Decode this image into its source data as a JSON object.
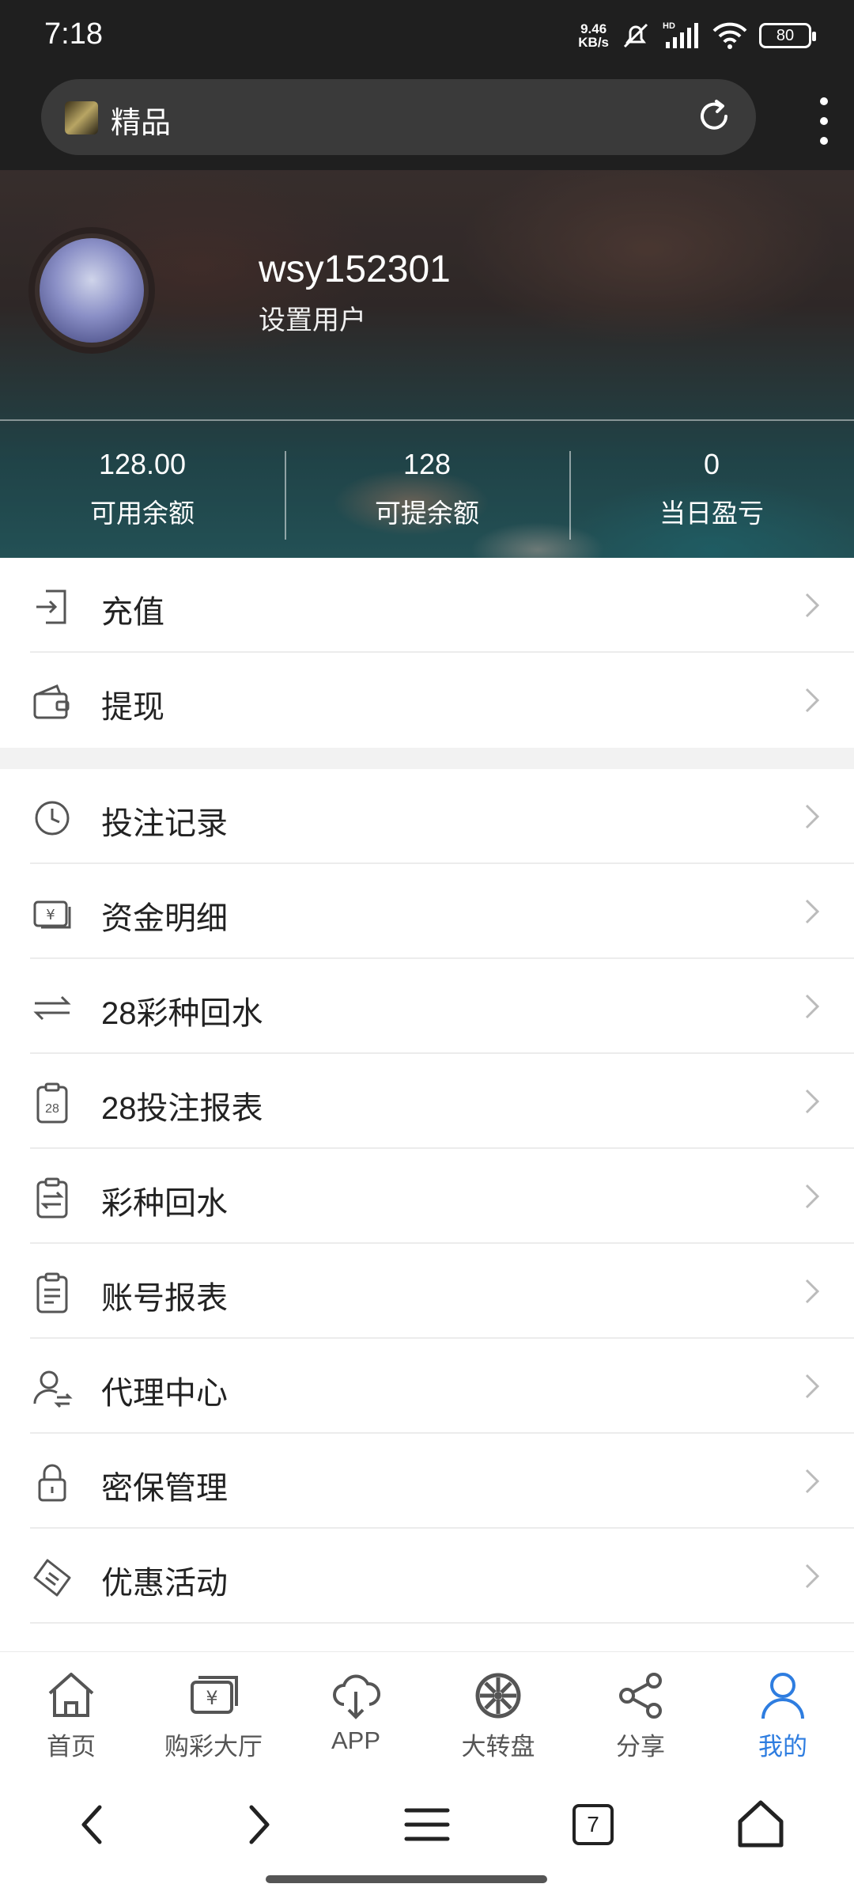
{
  "status_bar": {
    "time": "7:18",
    "net_speed_value": "9.46",
    "net_speed_unit": "KB/s",
    "battery": "80",
    "icons": [
      "mute-icon",
      "hd-signal-icon",
      "wifi-icon",
      "battery-icon"
    ]
  },
  "browser": {
    "page_title": "精品",
    "icons": [
      "favicon",
      "reload-icon",
      "more-vertical-icon"
    ]
  },
  "profile": {
    "username": "wsy152301",
    "subtitle": "设置用户"
  },
  "stats": [
    {
      "value": "128.00",
      "label": "可用余额"
    },
    {
      "value": "128",
      "label": "可提余额"
    },
    {
      "value": "0",
      "label": "当日盈亏"
    }
  ],
  "menu_group1": [
    {
      "label": "充值",
      "icon": "deposit-icon"
    },
    {
      "label": "提现",
      "icon": "wallet-icon"
    }
  ],
  "menu_group2": [
    {
      "label": "投注记录",
      "icon": "clock-icon"
    },
    {
      "label": "资金明细",
      "icon": "money-icon"
    },
    {
      "label": "28彩种回水",
      "icon": "transfer-icon"
    },
    {
      "label": "28投注报表",
      "icon": "report-28-icon"
    },
    {
      "label": "彩种回水",
      "icon": "clipboard-transfer-icon"
    },
    {
      "label": "账号报表",
      "icon": "clipboard-icon"
    },
    {
      "label": "代理中心",
      "icon": "agent-icon"
    },
    {
      "label": "密保管理",
      "icon": "lock-icon"
    },
    {
      "label": "优惠活动",
      "icon": "ticket-icon"
    }
  ],
  "tabbar": [
    {
      "label": "首页",
      "icon": "home-icon",
      "active": false
    },
    {
      "label": "购彩大厅",
      "icon": "lottery-hall-icon",
      "active": false
    },
    {
      "label": "APP",
      "icon": "cloud-download-icon",
      "active": false
    },
    {
      "label": "大转盘",
      "icon": "wheel-icon",
      "active": false
    },
    {
      "label": "分享",
      "icon": "share-icon",
      "active": false
    },
    {
      "label": "我的",
      "icon": "user-icon",
      "active": true
    }
  ],
  "system_nav": {
    "tab_count": "7"
  },
  "colors": {
    "accent": "#2e7de0",
    "dark_bar": "#1f1f1f"
  }
}
